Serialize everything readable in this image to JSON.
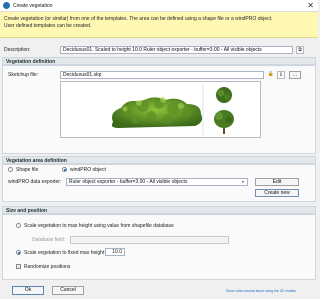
{
  "window": {
    "title": "Create vegetation",
    "close_glyph": "✕"
  },
  "banner": {
    "line1": "Create vegetation (or similar) from one of the templates. The area can be defined using a shape file or a windPRO object.",
    "line2": "User defined templates can be created."
  },
  "description": {
    "label": "Description:",
    "value": "Deciduous01. Scaled to height 10.0 Ruler object exporter - buffer=3.00 - All visible objects"
  },
  "vegetation_definition": {
    "header": "Vegetation definition",
    "sketchup_label": "Sketchup file:",
    "sketchup_value": "Deciduous01.skp",
    "browse_label": "..."
  },
  "area_definition": {
    "header": "Vegetation area definition",
    "option_shape": "Shape file",
    "option_windpro": "windPRO object",
    "selected": "windPRO object",
    "exporter_label": "windPRO data exporter:",
    "exporter_value": "Ruler object exporter - buffer=3.00 - All visible objects",
    "edit_label": "Edit",
    "create_new_label": "Create new"
  },
  "size_position": {
    "header": "Size and position",
    "option_shapefile_height": "Scale vegetation to max height using value from shapefile database",
    "database_field_label": "Database field:",
    "option_fixed_height": "Scale vegetation to fixed max height",
    "fixed_height_value": "10.0",
    "randomize_label": "Randomize positions",
    "randomize_checked": true,
    "check_glyph": "✓"
  },
  "footer": {
    "ok_label": "Ok",
    "cancel_label": "Cancel",
    "link_text": "Show video tutorial about using the 3D models"
  },
  "colors": {
    "banner": "#fff8b3",
    "accent": "#1a62b8",
    "link": "#2a6fc8"
  },
  "icons": [
    "app-globe-icon",
    "close-icon",
    "copy-icon",
    "lock-icon",
    "info-icon",
    "tree-3d-icon"
  ]
}
